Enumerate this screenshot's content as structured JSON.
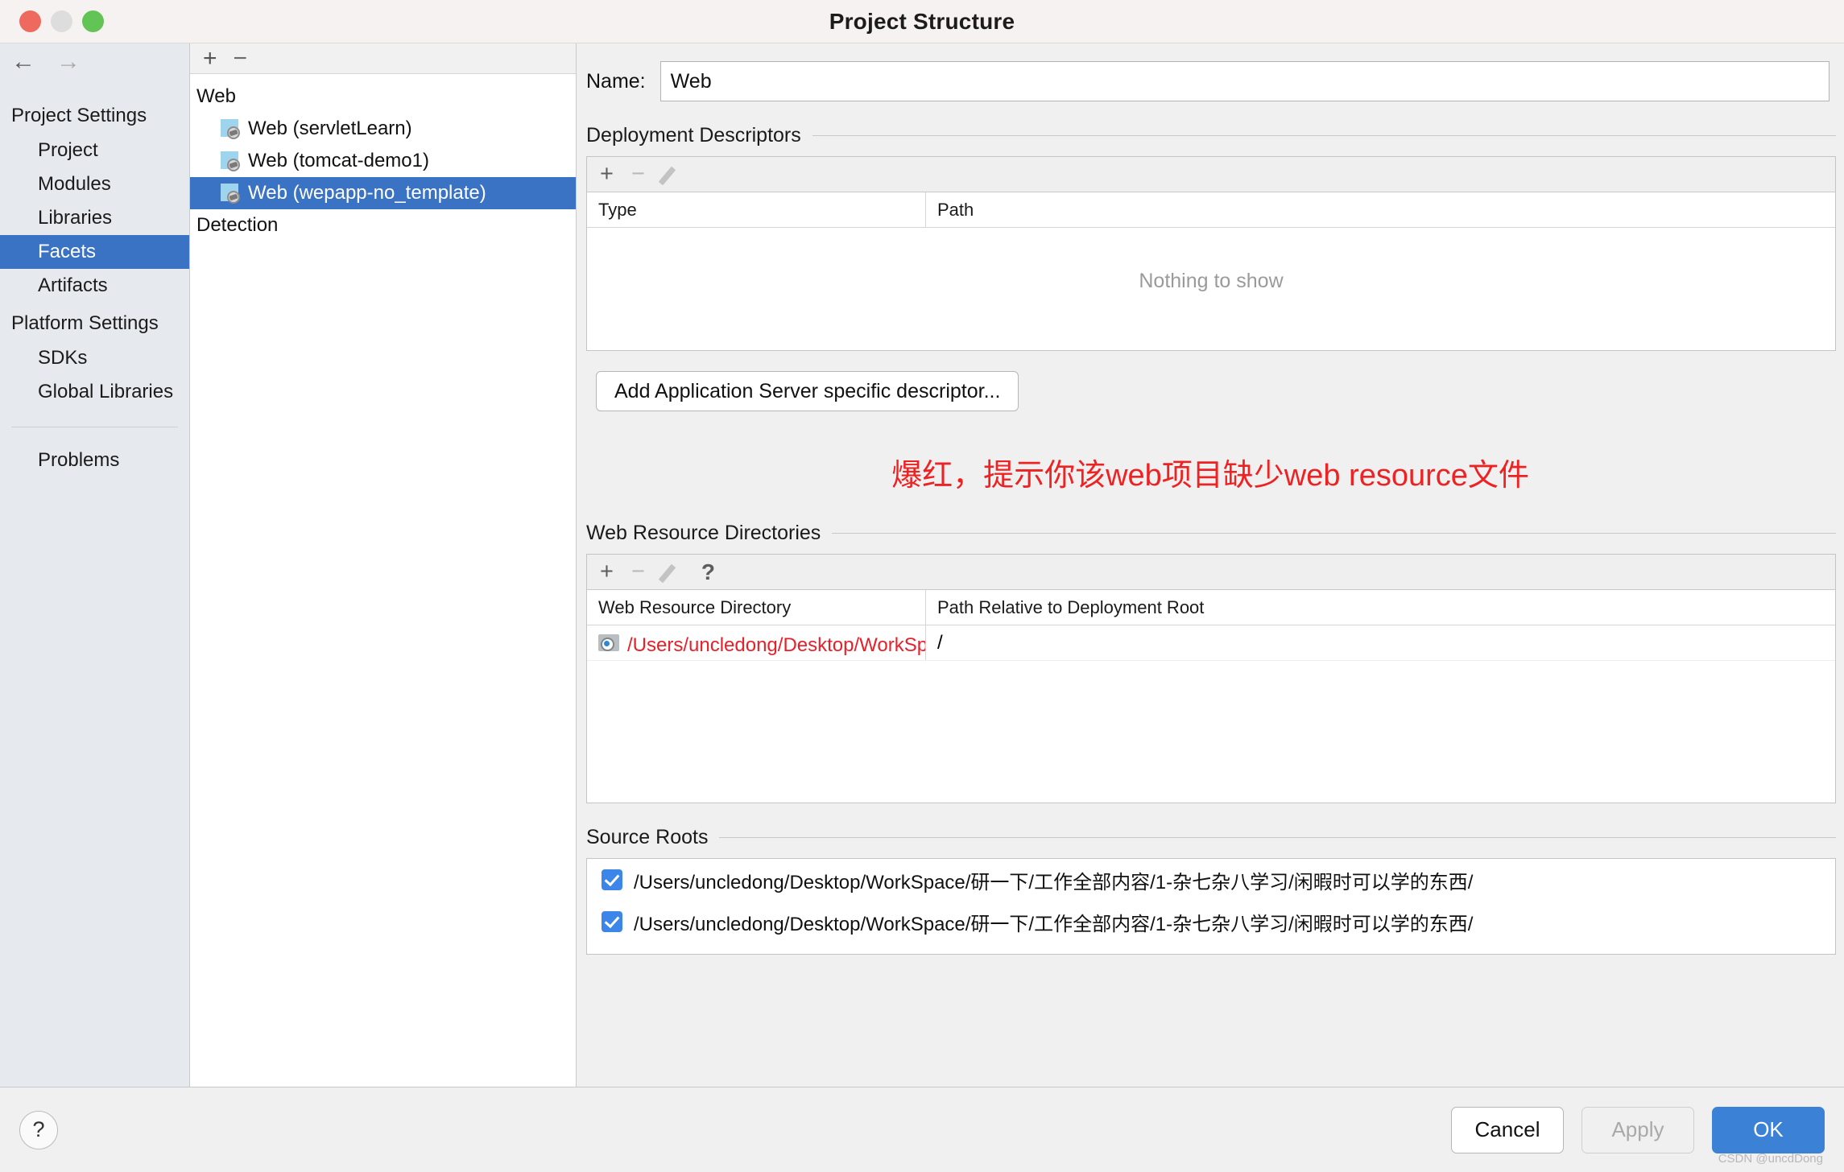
{
  "window": {
    "title": "Project Structure",
    "traffic_lights": [
      "close",
      "minimize",
      "zoom"
    ]
  },
  "sidebar": {
    "back_icon": "arrow-left-icon",
    "forward_icon": "arrow-right-icon",
    "groups": [
      {
        "label": "Project Settings",
        "items": [
          {
            "label": "Project",
            "selected": false
          },
          {
            "label": "Modules",
            "selected": false
          },
          {
            "label": "Libraries",
            "selected": false
          },
          {
            "label": "Facets",
            "selected": true
          },
          {
            "label": "Artifacts",
            "selected": false
          }
        ]
      },
      {
        "label": "Platform Settings",
        "items": [
          {
            "label": "SDKs",
            "selected": false
          },
          {
            "label": "Global Libraries",
            "selected": false
          }
        ]
      }
    ],
    "standalone_items": [
      {
        "label": "Problems",
        "selected": false
      }
    ]
  },
  "tree": {
    "toolbar": {
      "add_label": "+",
      "remove_label": "−"
    },
    "nodes": [
      {
        "label": "Web",
        "type": "group",
        "selected": false
      },
      {
        "label": "Web (servletLearn)",
        "type": "facet",
        "selected": false
      },
      {
        "label": "Web (tomcat-demo1)",
        "type": "facet",
        "selected": false
      },
      {
        "label": "Web (wepapp-no_template)",
        "type": "facet",
        "selected": true
      },
      {
        "label": "Detection",
        "type": "group",
        "selected": false
      }
    ]
  },
  "detail": {
    "name_label": "Name:",
    "name_value": "Web",
    "deployment": {
      "section_title": "Deployment Descriptors",
      "toolbar": {
        "add": "+",
        "remove": "−",
        "edit": "pencil-icon"
      },
      "columns": [
        "Type",
        "Path"
      ],
      "rows": [],
      "empty_text": "Nothing to show",
      "add_descriptor_button": "Add Application Server specific descriptor..."
    },
    "annotation": "爆红，提示你该web项目缺少web resource文件",
    "annotation_color": "#ee2222",
    "web_resources": {
      "section_title": "Web Resource Directories",
      "toolbar": {
        "add": "+",
        "remove": "−",
        "edit": "pencil-icon",
        "help": "?"
      },
      "columns": [
        "Web Resource Directory",
        "Path Relative to Deployment Root"
      ],
      "rows": [
        {
          "directory": "/Users/uncledong/Desktop/WorkSpace/研...",
          "directory_error": true,
          "relative_path": "/"
        }
      ]
    },
    "source_roots": {
      "section_title": "Source Roots",
      "rows": [
        {
          "checked": true,
          "path": "/Users/uncledong/Desktop/WorkSpace/研一下/工作全部内容/1-杂七杂八学习/闲暇时可以学的东西/"
        },
        {
          "checked": true,
          "path": "/Users/uncledong/Desktop/WorkSpace/研一下/工作全部内容/1-杂七杂八学习/闲暇时可以学的东西/"
        }
      ]
    }
  },
  "footer": {
    "help": "?",
    "cancel": "Cancel",
    "apply": "Apply",
    "ok": "OK",
    "watermark": "CSDN @uncdDong"
  }
}
